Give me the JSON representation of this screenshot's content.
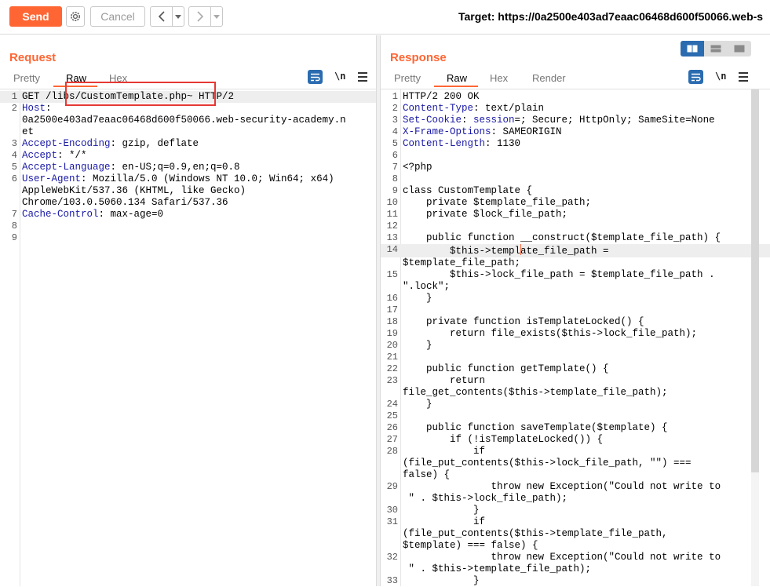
{
  "toolbar": {
    "send_label": "Send",
    "cancel_label": "Cancel",
    "back_label": "<",
    "forward_label": ">",
    "dropdown_label": "▾",
    "target_text": "Target: https://0a2500e403ad7eaac06468d600f50066.web-s"
  },
  "request": {
    "title": "Request",
    "tabs": [
      "Pretty",
      "Raw",
      "Hex"
    ],
    "active_tab": "Raw",
    "newline_label": "\\n",
    "lines": [
      {
        "n": "1",
        "key": "",
        "text": "GET /libs/CustomTemplate.php~ HTTP/2"
      },
      {
        "n": "2",
        "key": "Host",
        "text": ":"
      },
      {
        "n": "",
        "key": "",
        "text": "0a2500e403ad7eaac06468d600f50066.web-security-academy.n"
      },
      {
        "n": "",
        "key": "",
        "text": "et"
      },
      {
        "n": "3",
        "key": "Accept-Encoding",
        "text": ": gzip, deflate"
      },
      {
        "n": "4",
        "key": "Accept",
        "text": ": */*"
      },
      {
        "n": "5",
        "key": "Accept-Language",
        "text": ": en-US;q=0.9,en;q=0.8"
      },
      {
        "n": "6",
        "key": "User-Agent",
        "text": ": Mozilla/5.0 (Windows NT 10.0; Win64; x64)"
      },
      {
        "n": "",
        "key": "",
        "text": "AppleWebKit/537.36 (KHTML, like Gecko)"
      },
      {
        "n": "",
        "key": "",
        "text": "Chrome/103.0.5060.134 Safari/537.36"
      },
      {
        "n": "7",
        "key": "Cache-Control",
        "text": ": max-age=0"
      },
      {
        "n": "8",
        "key": "",
        "text": ""
      },
      {
        "n": "9",
        "key": "",
        "text": ""
      }
    ]
  },
  "response": {
    "title": "Response",
    "tabs": [
      "Pretty",
      "Raw",
      "Hex",
      "Render"
    ],
    "active_tab": "Raw",
    "newline_label": "\\n",
    "lines": [
      {
        "n": "1",
        "key": "",
        "text": "HTTP/2 200 OK"
      },
      {
        "n": "2",
        "key": "Content-Type",
        "text": ": text/plain"
      },
      {
        "n": "3",
        "key": "Set-Cookie",
        "text": ": ",
        "key2": "session",
        "text2": "=; Secure; HttpOnly; SameSite=None"
      },
      {
        "n": "4",
        "key": "X-Frame-Options",
        "text": ": SAMEORIGIN"
      },
      {
        "n": "5",
        "key": "Content-Length",
        "text": ": 1130"
      },
      {
        "n": "6",
        "key": "",
        "text": ""
      },
      {
        "n": "7",
        "key": "",
        "text": "<?php"
      },
      {
        "n": "8",
        "key": "",
        "text": ""
      },
      {
        "n": "9",
        "key": "",
        "text": "class CustomTemplate {"
      },
      {
        "n": "10",
        "key": "",
        "text": "    private $template_file_path;"
      },
      {
        "n": "11",
        "key": "",
        "text": "    private $lock_file_path;"
      },
      {
        "n": "12",
        "key": "",
        "text": ""
      },
      {
        "n": "13",
        "key": "",
        "text": "    public function __construct($template_file_path) {"
      },
      {
        "n": "14",
        "key": "",
        "text": "        $this->template_file_path =",
        "caret": true
      },
      {
        "n": "",
        "key": "",
        "text": "$template_file_path;"
      },
      {
        "n": "15",
        "key": "",
        "text": "        $this->lock_file_path = $template_file_path ."
      },
      {
        "n": "",
        "key": "",
        "text": "\".lock\";"
      },
      {
        "n": "16",
        "key": "",
        "text": "    }"
      },
      {
        "n": "17",
        "key": "",
        "text": ""
      },
      {
        "n": "18",
        "key": "",
        "text": "    private function isTemplateLocked() {"
      },
      {
        "n": "19",
        "key": "",
        "text": "        return file_exists($this->lock_file_path);"
      },
      {
        "n": "20",
        "key": "",
        "text": "    }"
      },
      {
        "n": "21",
        "key": "",
        "text": ""
      },
      {
        "n": "22",
        "key": "",
        "text": "    public function getTemplate() {"
      },
      {
        "n": "23",
        "key": "",
        "text": "        return"
      },
      {
        "n": "",
        "key": "",
        "text": "file_get_contents($this->template_file_path);"
      },
      {
        "n": "24",
        "key": "",
        "text": "    }"
      },
      {
        "n": "25",
        "key": "",
        "text": ""
      },
      {
        "n": "26",
        "key": "",
        "text": "    public function saveTemplate($template) {"
      },
      {
        "n": "27",
        "key": "",
        "text": "        if (!isTemplateLocked()) {"
      },
      {
        "n": "28",
        "key": "",
        "text": "            if"
      },
      {
        "n": "",
        "key": "",
        "text": "(file_put_contents($this->lock_file_path, \"\") ==="
      },
      {
        "n": "",
        "key": "",
        "text": "false) {"
      },
      {
        "n": "29",
        "key": "",
        "text": "               throw new Exception(\"Could not write to"
      },
      {
        "n": "",
        "key": "",
        "text": " \" . $this->lock_file_path);"
      },
      {
        "n": "30",
        "key": "",
        "text": "            }"
      },
      {
        "n": "31",
        "key": "",
        "text": "            if"
      },
      {
        "n": "",
        "key": "",
        "text": "(file_put_contents($this->template_file_path,"
      },
      {
        "n": "",
        "key": "",
        "text": "$template) === false) {"
      },
      {
        "n": "32",
        "key": "",
        "text": "               throw new Exception(\"Could not write to"
      },
      {
        "n": "",
        "key": "",
        "text": " \" . $this->template_file_path);"
      },
      {
        "n": "33",
        "key": "",
        "text": "            }"
      }
    ]
  },
  "colors": {
    "accent": "#ff6633",
    "header_key": "#1a1aa6",
    "highlight_box": "#e53935",
    "toggle_active": "#2b6cb0"
  },
  "icons": {
    "settings": "gear-icon",
    "wrap": "word-wrap-icon",
    "menu": "hamburger-menu-icon",
    "layout_split": "split-view-icon"
  }
}
